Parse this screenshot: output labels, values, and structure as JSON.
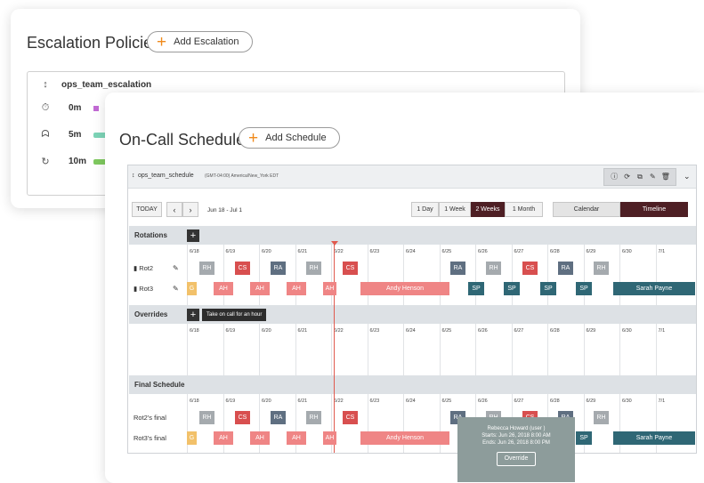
{
  "escalation": {
    "title": "Escalation Policies",
    "add_label": "Add Escalation",
    "policy_name": "ops_team_escalation",
    "rows": [
      {
        "delay": "0m"
      },
      {
        "delay": "5m"
      },
      {
        "delay": "10m"
      }
    ]
  },
  "oncall": {
    "title": "On-Call Schedules",
    "add_label": "Add Schedule",
    "schedule_name": "ops_team_schedule",
    "timezone": "(GMT-04:00) America/New_York EDT",
    "today_label": "TODAY",
    "date_range": "Jun 18 - Jul 1",
    "ranges": [
      "1 Day",
      "1 Week",
      "2 Weeks",
      "1 Month"
    ],
    "active_range": "2 Weeks",
    "views": [
      "Calendar",
      "Timeline"
    ],
    "active_view": "Timeline",
    "days": [
      "6/18",
      "6/19",
      "6/20",
      "6/21",
      "6/22",
      "6/23",
      "6/24",
      "6/25",
      "6/26",
      "6/27",
      "6/28",
      "6/29",
      "6/30",
      "7/1"
    ],
    "rotations_label": "Rotations",
    "rot2": "Rot2",
    "rot3": "Rot3",
    "overrides_label": "Overrides",
    "override_tip": "Take on call for an hour",
    "final_label": "Final Schedule",
    "rot2_final": "Rot2's final",
    "rot3_final": "Rot3's final",
    "tooltip": {
      "name": "Rebecca Howard  (user )",
      "starts": "Starts: Jun 26, 2018 8:00 AM",
      "ends": "Ends: Jun 26, 2018 8:00 PM",
      "button": "Override"
    },
    "rot2_blocks": [
      "RH",
      "CS",
      "RA",
      "RH",
      "CS",
      "RA",
      "RH",
      "CS",
      "RA",
      "RH"
    ],
    "rot3_blocks": [
      "G",
      "AH",
      "AH",
      "AH",
      "AH",
      "Andy Henson",
      "SP",
      "SP",
      "SP",
      "SP",
      "Sarah Payne"
    ]
  }
}
